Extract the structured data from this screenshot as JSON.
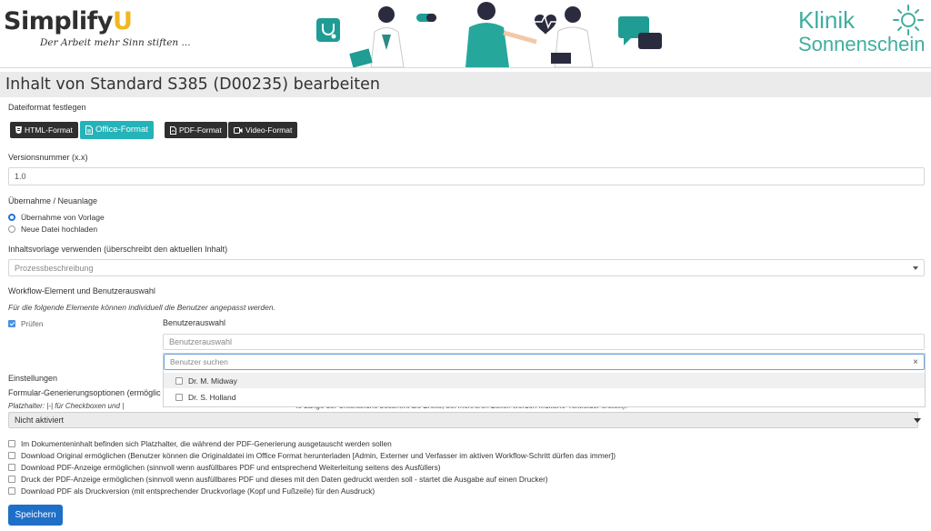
{
  "brand": {
    "name_part1": "Simplify",
    "name_part2": "U",
    "tagline": "Der Arbeit mehr Sinn stiften ..."
  },
  "clinic": {
    "line1": "Klinik",
    "line2": "Sonnenschein"
  },
  "colors": {
    "accent": "#24b3b8",
    "primary": "#1f6fc9",
    "clinic_green": "#3fae9f",
    "dark_button": "#2f2f2f"
  },
  "page": {
    "title": "Inhalt von Standard S385 (D00235) bearbeiten"
  },
  "file_format": {
    "label": "Dateiformat festlegen",
    "buttons": [
      {
        "label": "HTML-Format",
        "icon": "html5-icon",
        "active": false
      },
      {
        "label": "Office-Format",
        "icon": "file-text-icon",
        "active": true
      },
      {
        "label": "PDF-Format",
        "icon": "file-pdf-icon",
        "active": false
      },
      {
        "label": "Video-Format",
        "icon": "video-camera-icon",
        "active": false
      }
    ]
  },
  "version": {
    "label": "Versionsnummer (x.x)",
    "value": "1.0"
  },
  "takeover": {
    "label": "Übernahme / Neuanlage",
    "options": [
      {
        "label": "Übernahme von Vorlage",
        "selected": true
      },
      {
        "label": "Neue Datei hochladen",
        "selected": false
      }
    ]
  },
  "template": {
    "label": "Inhaltsvorlage verwenden (überschreibt den aktuellen Inhalt)",
    "selected": "Prozessbeschreibung"
  },
  "workflow": {
    "label": "Workflow-Element und Benutzerauswahl",
    "note": "Für die folgende Elemente können individuell die Benutzer angepasst werden.",
    "element": {
      "label": "Prüfen",
      "checked": true
    },
    "user_select_label": "Benutzerauswahl",
    "user_select_placeholder": "Benutzerauswahl",
    "search_placeholder": "Benutzer suchen",
    "clear_symbol": "×",
    "users": [
      {
        "name": "Dr. M. Midway",
        "checked": false
      },
      {
        "name": "Dr. S. Holland",
        "checked": false
      }
    ]
  },
  "settings": {
    "label": "Einstellungen",
    "generation_label": "Formular-Generierungsoptionen (ermöglic",
    "placeholder_note_left": "Platzhalter: |-| für Checkboxen und |",
    "placeholder_note_right": "ie Länge der Unterstriche bestimmt die Breite, bei mehreren Zeilen werden Mulitline-Textfelder erstellt).",
    "generation_selected": "Nicht aktiviert",
    "options": [
      {
        "label": "Im Dokumenteninhalt befinden sich Platzhalter, die während der PDF-Generierung ausgetauscht werden sollen",
        "checked": false
      },
      {
        "label": "Download Original ermöglichen (Benutzer können die Originaldatei im Office Format herunterladen [Admin, Externer und Verfasser im aktiven Workflow-Schritt dürfen das immer])",
        "checked": false
      },
      {
        "label": "Download PDF-Anzeige ermöglichen (sinnvoll wenn ausfüllbares PDF und entsprechend Weiterleitung seitens des Ausfüllers)",
        "checked": false
      },
      {
        "label": "Druck der PDF-Anzeige ermöglichen (sinnvoll wenn ausfüllbares PDF und dieses mit den Daten gedruckt werden soll - startet die Ausgabe auf einen Drucker)",
        "checked": false
      },
      {
        "label": "Download PDF als Druckversion (mit entsprechender Druckvorlage (Kopf und Fußzeile) für den Ausdruck)",
        "checked": false
      }
    ]
  },
  "actions": {
    "save_label": "Speichern"
  }
}
